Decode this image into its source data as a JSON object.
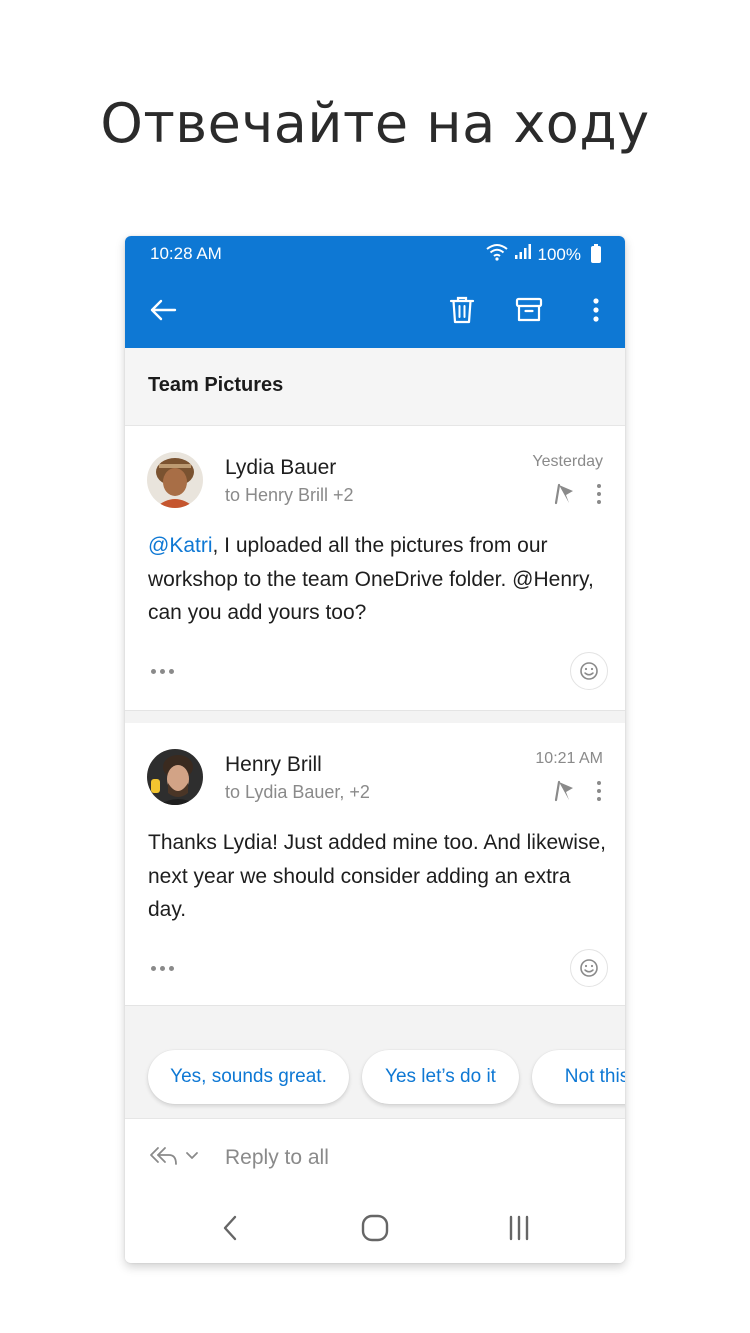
{
  "headline": "Отвечайте на ходу",
  "status_bar": {
    "time": "10:28 AM",
    "battery": "100%",
    "icons": [
      "wifi-icon",
      "signal-icon",
      "battery-icon"
    ]
  },
  "toolbar": {
    "icons": [
      "back-arrow-icon",
      "trash-icon",
      "archive-icon",
      "more-vertical-icon"
    ]
  },
  "thread": {
    "subject": "Team Pictures",
    "messages": [
      {
        "sender": "Lydia Bauer",
        "recipients": "to Henry Brill +2",
        "time": "Yesterday",
        "mention": "@Katri",
        "body": ", I uploaded all the pictures from our workshop to the team OneDrive folder. @Henry, can you add yours too?"
      },
      {
        "sender": "Henry Brill",
        "recipients": "to Lydia Bauer, +2",
        "time": "10:21 AM",
        "body": "Thanks Lydia! Just added mine too. And likewise, next year we should consider adding an extra day."
      }
    ]
  },
  "suggested_replies": [
    "Yes, sounds great.",
    "Yes let’s do it",
    "Not this"
  ],
  "reply_bar": {
    "placeholder": "Reply to all"
  },
  "colors": {
    "brand": "#0e78d4",
    "muted_text": "#8a8a8a",
    "background_gray": "#f3f3f3"
  }
}
